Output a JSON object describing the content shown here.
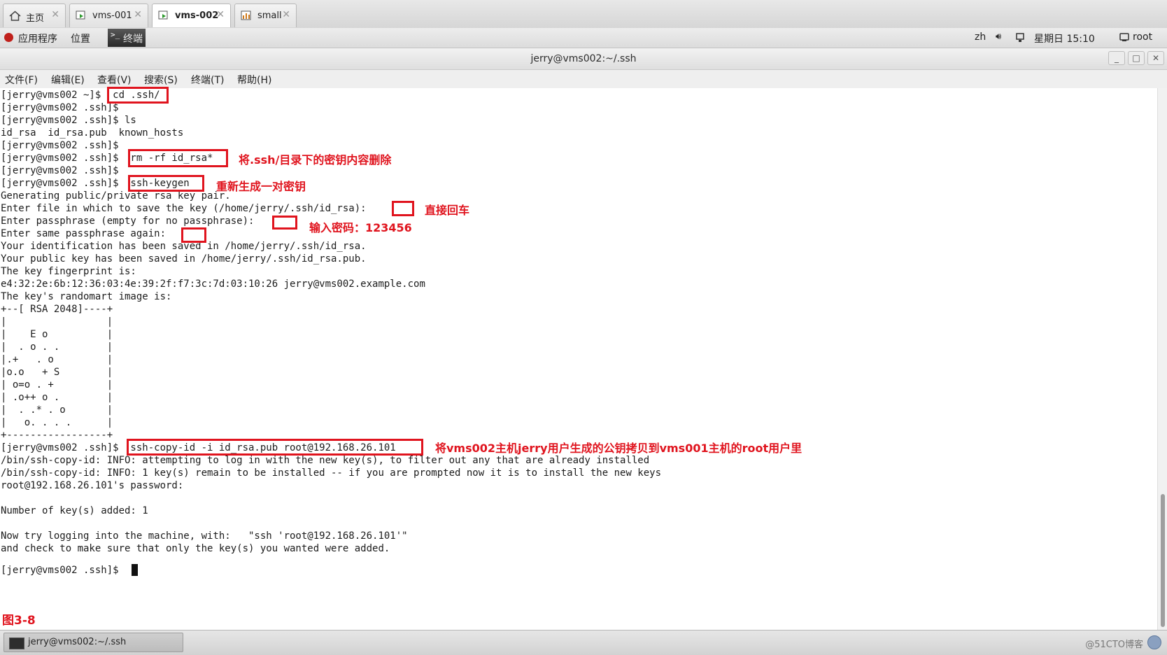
{
  "tabs": [
    {
      "label": "主页",
      "icon": "home-icon",
      "active": false
    },
    {
      "label": "vms-001",
      "icon": "vm-icon",
      "active": false
    },
    {
      "label": "vms-002",
      "icon": "vm-icon",
      "active": true
    },
    {
      "label": "small",
      "icon": "chart-icon",
      "active": false
    }
  ],
  "panel": {
    "applications": "应用程序",
    "places": "位置",
    "terminal": "终端",
    "lang": "zh",
    "datetime": "星期日 15:10",
    "user": "root"
  },
  "window": {
    "title": "jerry@vms002:~/.ssh",
    "menu": [
      "文件(F)",
      "编辑(E)",
      "查看(V)",
      "搜索(S)",
      "终端(T)",
      "帮助(H)"
    ]
  },
  "terminal_lines": [
    "[jerry@vms002 ~]$  cd .ssh/",
    "[jerry@vms002 .ssh]$",
    "[jerry@vms002 .ssh]$ ls",
    "id_rsa  id_rsa.pub  known_hosts",
    "[jerry@vms002 .ssh]$",
    "[jerry@vms002 .ssh]$  rm -rf id_rsa*",
    "[jerry@vms002 .ssh]$",
    "[jerry@vms002 .ssh]$  ssh-keygen",
    "Generating public/private rsa key pair.",
    "Enter file in which to save the key (/home/jerry/.ssh/id_rsa):",
    "Enter passphrase (empty for no passphrase):",
    "Enter same passphrase again:",
    "Your identification has been saved in /home/jerry/.ssh/id_rsa.",
    "Your public key has been saved in /home/jerry/.ssh/id_rsa.pub.",
    "The key fingerprint is:",
    "e4:32:2e:6b:12:36:03:4e:39:2f:f7:3c:7d:03:10:26 jerry@vms002.example.com",
    "The key's randomart image is:",
    "+--[ RSA 2048]----+",
    "|                 |",
    "|    E o          |",
    "|  . o . .        |",
    "|.+   . o         |",
    "|o.o   + S        |",
    "| o=o . +         |",
    "| .o++ o .        |",
    "|  . .* . o       |",
    "|   o. . . .      |",
    "+-----------------+",
    "[jerry@vms002 .ssh]$  ssh-copy-id -i id_rsa.pub root@192.168.26.101",
    "/bin/ssh-copy-id: INFO: attempting to log in with the new key(s), to filter out any that are already installed",
    "/bin/ssh-copy-id: INFO: 1 key(s) remain to be installed -- if you are prompted now it is to install the new keys",
    "root@192.168.26.101's password:",
    "",
    "Number of key(s) added: 1",
    "",
    "Now try logging into the machine, with:   \"ssh 'root@192.168.26.101'\"",
    "and check to make sure that only the key(s) you wanted were added.",
    "",
    "[jerry@vms002 .ssh]$"
  ],
  "annotations": {
    "rm_note": "将.ssh/目录下的密钥内容删除",
    "keygen_note": "重新生成一对密钥",
    "enter_note": "直接回车",
    "password_note": "输入密码：123456",
    "copy_note": "将vms002主机jerry用户生成的公钥拷贝到vms001主机的root用户里"
  },
  "figure_label": "图3-8",
  "taskbar": {
    "item": "jerry@vms002:~/.ssh",
    "watermark": "@51CTO博客"
  },
  "colors": {
    "annotation": "#e0141e"
  }
}
